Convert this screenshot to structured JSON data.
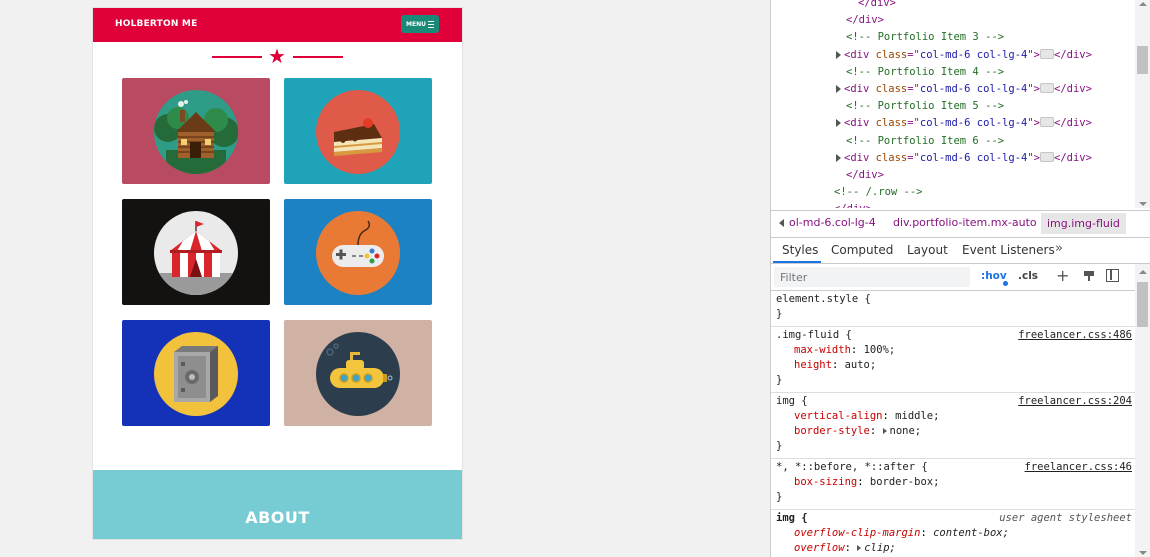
{
  "preview": {
    "brand": "HOLBERTON ME",
    "menu_label": "MENU",
    "about_title": "ABOUT",
    "colors": {
      "primary": "#e0003a",
      "nav_button": "#1a8a78",
      "about_bg": "#76ccd2"
    },
    "portfolio_items": [
      {
        "icon": "cabin-icon",
        "bg": "#b84a62"
      },
      {
        "icon": "cake-icon",
        "bg": "#1fa3b8"
      },
      {
        "icon": "circus-tent-icon",
        "bg": "#141210"
      },
      {
        "icon": "game-controller-icon",
        "bg": "#1c82c4"
      },
      {
        "icon": "safe-icon",
        "bg": "#1432b8"
      },
      {
        "icon": "submarine-icon",
        "bg": "#cfb2a4"
      }
    ]
  },
  "devtools": {
    "dom_lines": [
      {
        "indent": 0,
        "kind": "close",
        "text": "</div>"
      },
      {
        "indent": 1,
        "kind": "close",
        "text": "</div>"
      },
      {
        "indent": 1,
        "kind": "comment",
        "text": "<!-- Portfolio Item 3 -->"
      },
      {
        "indent": 1,
        "kind": "div",
        "tag": "div",
        "attr": "class",
        "value": "col-md-6 col-lg-4"
      },
      {
        "indent": 1,
        "kind": "comment",
        "text": "<!-- Portfolio Item 4 -->"
      },
      {
        "indent": 1,
        "kind": "div",
        "tag": "div",
        "attr": "class",
        "value": "col-md-6 col-lg-4"
      },
      {
        "indent": 1,
        "kind": "comment",
        "text": "<!-- Portfolio Item 5 -->"
      },
      {
        "indent": 1,
        "kind": "div",
        "tag": "div",
        "attr": "class",
        "value": "col-md-6 col-lg-4"
      },
      {
        "indent": 1,
        "kind": "comment",
        "text": "<!-- Portfolio Item 6 -->"
      },
      {
        "indent": 1,
        "kind": "div",
        "tag": "div",
        "attr": "class",
        "value": "col-md-6 col-lg-4"
      },
      {
        "indent": 1,
        "kind": "close",
        "text": "</div>"
      },
      {
        "indent": 2,
        "kind": "comment",
        "text": "<!-- /.row -->"
      },
      {
        "indent": 2,
        "kind": "close",
        "text": "</div>"
      }
    ],
    "breadcrumbs": [
      "ol-md-6.col-lg-4",
      "div.portfolio-item.mx-auto",
      "img.img-fluid"
    ],
    "tabs": [
      "Styles",
      "Computed",
      "Layout",
      "Event Listeners"
    ],
    "filter_placeholder": "Filter",
    "hov_label": ":hov",
    "cls_label": ".cls",
    "rules": [
      {
        "selector": "element.style {",
        "source": "",
        "props": []
      },
      {
        "selector": ".img-fluid {",
        "source": "freelancer.css:486",
        "props": [
          {
            "name": "max-width",
            "value": "100%;"
          },
          {
            "name": "height",
            "value": "auto;"
          }
        ]
      },
      {
        "selector": "img {",
        "source": "freelancer.css:204",
        "props": [
          {
            "name": "vertical-align",
            "value": "middle;"
          },
          {
            "name": "border-style",
            "value": "none;",
            "expand": true
          }
        ]
      },
      {
        "selector": "*, *::before, *::after {",
        "source": "freelancer.css:46",
        "props": [
          {
            "name": "box-sizing",
            "value": "border-box;"
          }
        ]
      },
      {
        "selector": "img {",
        "source": "user agent stylesheet",
        "ua": true,
        "props": [
          {
            "name": "overflow-clip-margin",
            "value": "content-box;",
            "italic": true
          },
          {
            "name": "overflow",
            "value": "clip;",
            "italic": true,
            "expand": true
          }
        ]
      }
    ]
  }
}
